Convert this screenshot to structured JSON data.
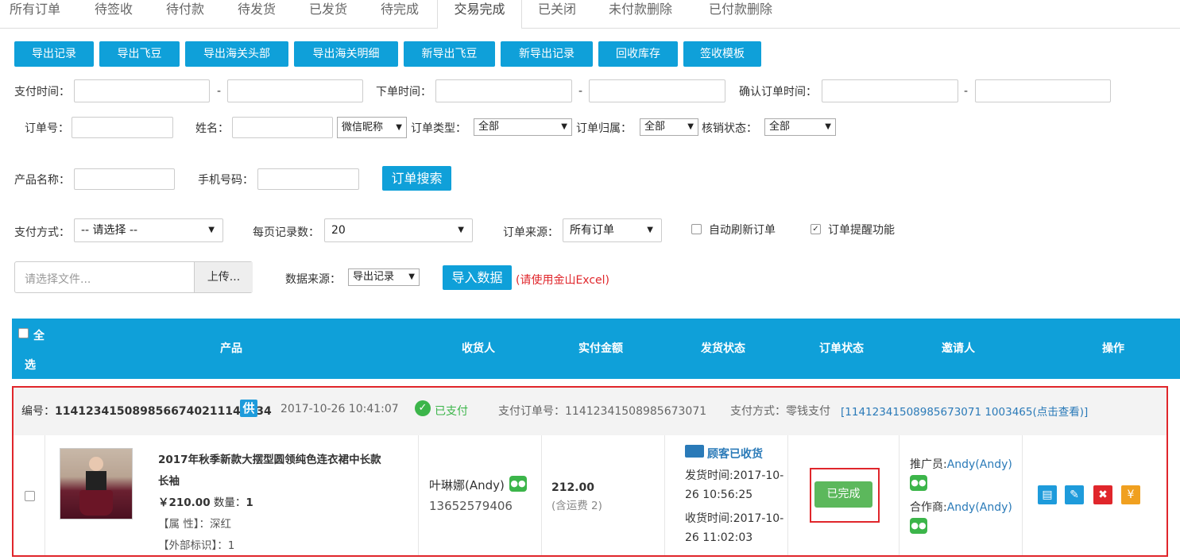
{
  "tabs": [
    "所有订单",
    "待签收",
    "待付款",
    "待发货",
    "已发货",
    "待完成",
    "交易完成",
    "已关闭",
    "未付款删除",
    "已付款删除"
  ],
  "active_tab": "交易完成",
  "toolbar": [
    "导出记录",
    "导出飞豆",
    "导出海关头部",
    "导出海关明细",
    "新导出飞豆",
    "新导出记录",
    "回收库存",
    "签收模板"
  ],
  "filters": {
    "pay_time": "支付时间：",
    "order_time": "下单时间：",
    "confirm_time": "确认订单时间：",
    "dash": "-",
    "order_no": "订单号：",
    "name": "姓名：",
    "name_type": "微信昵称",
    "order_type": "订单类型：",
    "order_type_value": "全部",
    "order_owner": "订单归属：",
    "order_owner_value": "全部",
    "verify_status": "核销状态：",
    "verify_status_value": "全部",
    "product_name": "产品名称：",
    "phone": "手机号码：",
    "search_button": "订单搜索",
    "pay_method": "支付方式：",
    "pay_method_value": "-- 请选择 --",
    "page_size": "每页记录数：",
    "page_size_value": "20",
    "order_source": "订单来源：",
    "order_source_value": "所有订单",
    "auto_refresh": "自动刷新订单",
    "order_reminder": "订单提醒功能",
    "file_placeholder": "请选择文件...",
    "upload_button": "上传...",
    "data_source": "数据来源：",
    "data_source_value": "导出记录",
    "import_button": "导入数据",
    "import_hint": "(请使用金山Excel)"
  },
  "table_header": {
    "select_all_1": "全",
    "select_all_2": "选",
    "product": "产品",
    "receiver": "收货人",
    "paid_amount": "实付金额",
    "ship_status": "发货状态",
    "order_status": "订单状态",
    "inviter": "邀请人",
    "actions": "操作"
  },
  "order": {
    "no_label": "编号：",
    "no": "1141234150898566740211141234",
    "supplier_badge": "供",
    "time": "2017-10-26 10:41:07",
    "paid_status": "已支付",
    "pay_order_label": "支付订单号：",
    "pay_order_no": "11412341508985673071",
    "pay_method_label": "支付方式：零钱支付",
    "pay_link": "[11412341508985673071 1003465(点击查看)]",
    "product_title_1": "2017年秋季新款大摆型圆领纯色连衣裙中长款",
    "product_title_2": "长袖",
    "price": "￥210.00",
    "qty_label": "数量：",
    "qty": "1",
    "attr": "【属 性】：深红",
    "ext": "【外部标识】：1",
    "receiver_name": "叶琳娜(Andy)",
    "receiver_phone": "13652579406",
    "amount": "212.00",
    "freight": "(含运费 2)",
    "ship_state": "顾客已收货",
    "ship_time_1": "发货时间:2017-10-",
    "ship_time_2": "26 10:56:25",
    "recv_time_1": "收货时间:2017-10-",
    "recv_time_2": "26 11:02:03",
    "status_button": "已完成",
    "promoter_label": "推广员:",
    "promoter": "Andy(Andy)",
    "partner_label": "合作商:",
    "partner": "Andy(Andy)"
  },
  "colors": {
    "primary": "#0fa0d9",
    "highlight": "#e0262b",
    "success": "#5cb85c",
    "link": "#2a7ab8"
  }
}
